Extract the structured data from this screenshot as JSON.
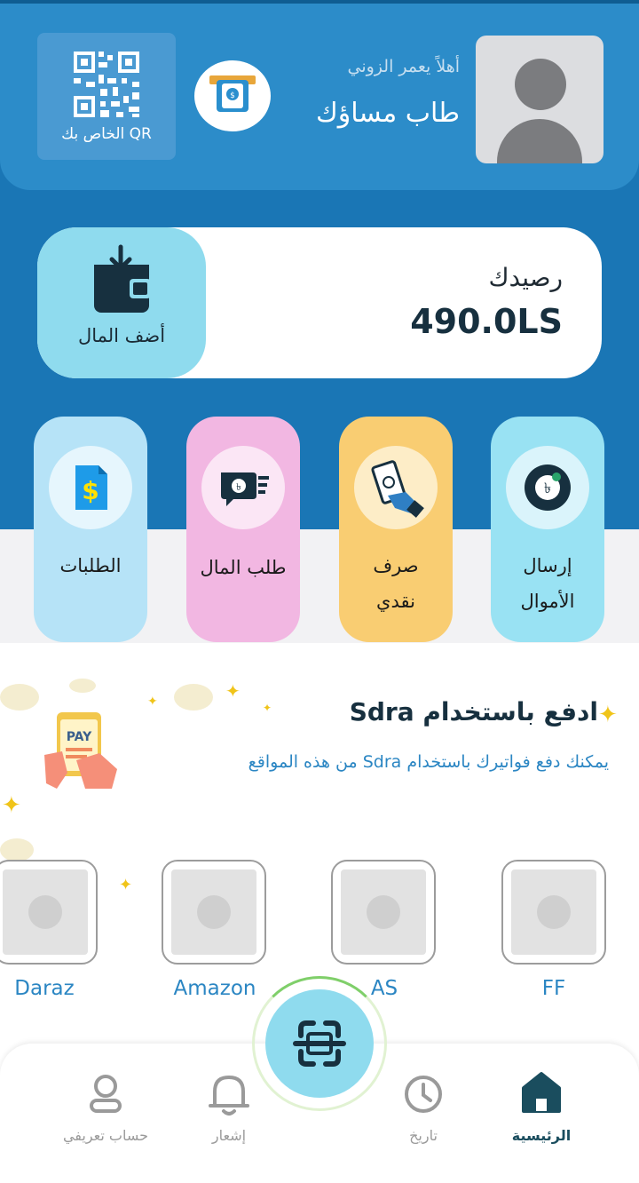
{
  "header": {
    "greeting": "أهلاً يعمر الزوني",
    "username": "طاب مساؤك",
    "qr_label": "QR الخاص بك"
  },
  "balance": {
    "label": "رصيدك",
    "value": "490.0LS",
    "add_money_label": "أضف المال"
  },
  "actions": [
    {
      "label": "الطلبات",
      "icon": "invoice-icon"
    },
    {
      "label": "طلب المال",
      "icon": "request-money-icon"
    },
    {
      "label_line1": "صرف",
      "label_line2": "نقدي",
      "icon": "cash-out-icon"
    },
    {
      "label_line1": "إرسال",
      "label_line2": "الأموال",
      "icon": "send-money-icon"
    }
  ],
  "promo": {
    "title": "ادفع باستخدام Sdra",
    "subtitle": "يمكنك دفع فواتيرك باستخدام Sdra من هذه المواقع",
    "badge": "PAY"
  },
  "merchants": [
    {
      "name": "Daraz"
    },
    {
      "name": "Amazon"
    },
    {
      "name": "AS"
    },
    {
      "name": "FF"
    }
  ],
  "nav": [
    {
      "label": "الرئيسية",
      "icon": "home-icon",
      "active": true
    },
    {
      "label": "تاريخ",
      "icon": "clock-icon"
    },
    {
      "label": "إشعار",
      "icon": "bell-icon"
    },
    {
      "label": "حساب تعريفي",
      "icon": "profile-icon"
    }
  ],
  "colors": {
    "primary_blue": "#1a76b5",
    "accent_cyan": "#8fdbee",
    "text_link": "#2b86c3",
    "dark_text": "#17303f"
  }
}
